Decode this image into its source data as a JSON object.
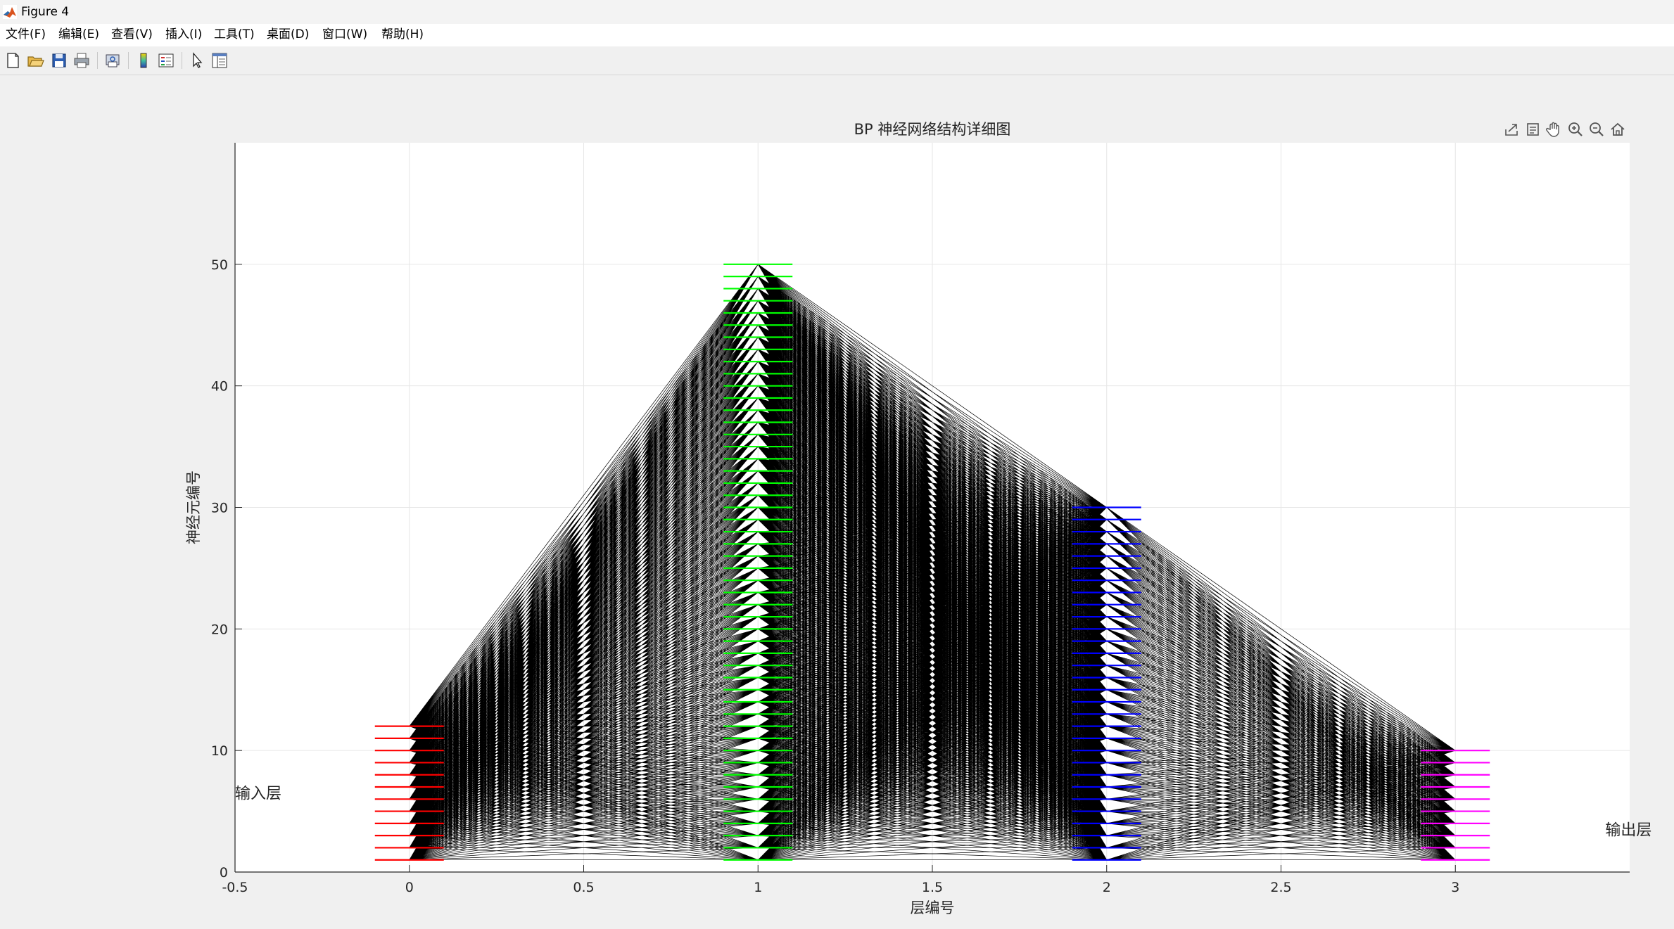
{
  "window": {
    "title": "Figure 4"
  },
  "menu": [
    "文件(F)",
    "编辑(E)",
    "查看(V)",
    "插入(I)",
    "工具(T)",
    "桌面(D)",
    "窗口(W)",
    "帮助(H)"
  ],
  "toolbar_icons": [
    "new-figure-icon",
    "open-file-icon",
    "save-icon",
    "print-icon",
    "print-preview-icon",
    "colorbar-icon",
    "legend-icon",
    "edit-plot-arrow-icon",
    "property-inspector-icon"
  ],
  "axes_toolbar_icons": [
    "export-icon",
    "brush-icon",
    "pan-hand-icon",
    "zoom-in-icon",
    "zoom-out-icon",
    "home-icon"
  ],
  "chart_data": {
    "type": "scatter",
    "title": "BP 神经网络结构详细图",
    "xlabel": "层编号",
    "ylabel": "神经元编号",
    "xlim": [
      -0.5,
      3.5
    ],
    "ylim": [
      0,
      60
    ],
    "xticks": [
      "-0.5",
      "0",
      "0.5",
      "1",
      "1.5",
      "2",
      "2.5",
      "3"
    ],
    "yticks": [
      "0",
      "10",
      "20",
      "30",
      "40",
      "50"
    ],
    "grid": true,
    "layers": [
      {
        "x": 0,
        "neurons": 12,
        "color": "#ff0000"
      },
      {
        "x": 1,
        "neurons": 50,
        "color": "#00ff00"
      },
      {
        "x": 2,
        "neurons": 30,
        "color": "#0000ff"
      },
      {
        "x": 3,
        "neurons": 10,
        "color": "#ff00ff"
      }
    ],
    "connections": [
      [
        0,
        1
      ],
      [
        1,
        2
      ],
      [
        2,
        3
      ]
    ],
    "connection_color": "#000000",
    "annotations": [
      {
        "text": "输入层",
        "x": -0.5,
        "y": 6.5
      },
      {
        "text": "输出层",
        "x": 3.43,
        "y": 3.5
      }
    ]
  }
}
